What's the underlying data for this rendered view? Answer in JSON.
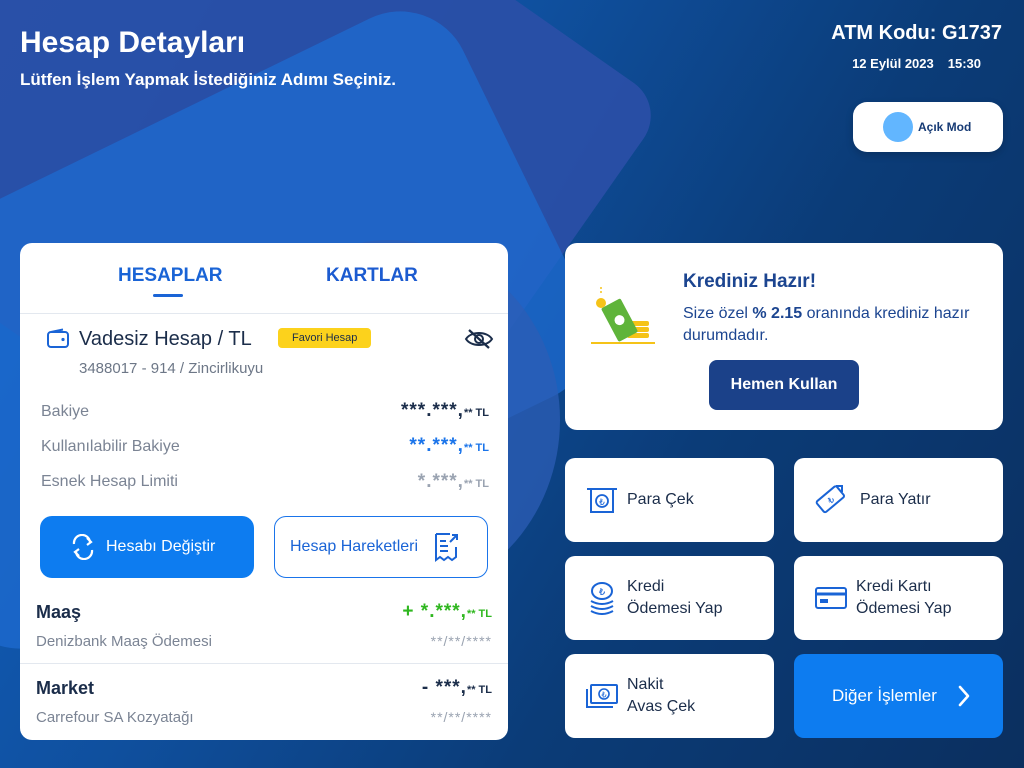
{
  "header": {
    "title": "Hesap Detayları",
    "subtitle": "Lütfen İşlem Yapmak İstediğiniz Adımı Seçiniz.",
    "atm_code": "ATM Kodu: G1737",
    "date": "12 Eylül 2023",
    "time": "15:30"
  },
  "mode_toggle": {
    "label": "Açık Mod"
  },
  "tabs": {
    "accounts": "HESAPLAR",
    "cards": "KARTLAR"
  },
  "account": {
    "name": "Vadesiz Hesap / TL",
    "badge": "Favori Hesap",
    "number": "3488017 - 914 / Zincirlikuyu",
    "rows": [
      {
        "label": "Bakiye",
        "value": "***.***,",
        "cur": "** TL"
      },
      {
        "label": "Kullanılabilir Bakiye",
        "value": "**.***,",
        "cur": "** TL"
      },
      {
        "label": "Esnek Hesap Limiti",
        "value": "*.***,",
        "cur": "** TL"
      }
    ]
  },
  "buttons": {
    "change_account": "Hesabı Değiştir",
    "account_history": "Hesap Hareketleri"
  },
  "transactions": [
    {
      "title": "Maaş",
      "desc": "Denizbank Maaş Ödemesi",
      "amount": "+ *.***,",
      "cur": "** TL",
      "date": "**/**/****"
    },
    {
      "title": "Market",
      "desc": "Carrefour SA Kozyatağı",
      "amount": "- ***,",
      "cur": "** TL",
      "date": "**/**/****"
    }
  ],
  "credit_promo": {
    "title": "Krediniz Hazır!",
    "text_pre": "Size özel ",
    "text_rate": "% 2.15",
    "text_post": " oranında krediniz hazır durumdadır.",
    "button": "Hemen Kullan"
  },
  "actions": {
    "withdraw": "Para Çek",
    "deposit": "Para Yatır",
    "loan_payment_1": "Kredi",
    "loan_payment_2": "Ödemesi Yap",
    "cc_payment_1": "Kredi Kartı",
    "cc_payment_2": "Ödemesi Yap",
    "cash_advance_1": "Nakit",
    "cash_advance_2": "Avas Çek",
    "other": "Diğer İşlemler"
  },
  "colors": {
    "primary": "#0d7cf0",
    "navy": "#1b4189",
    "badge": "#fcd21c",
    "income": "#2fb71f"
  }
}
